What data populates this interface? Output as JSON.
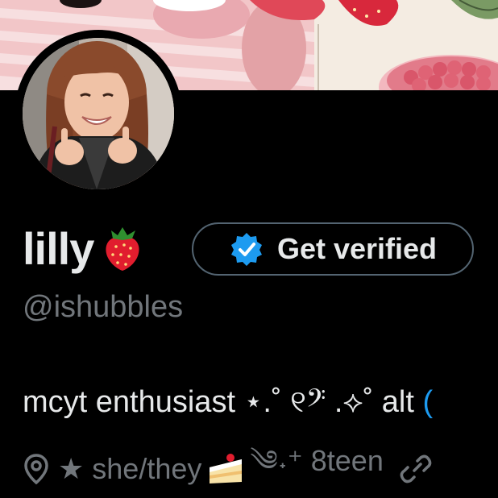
{
  "profile": {
    "display_name": "lilly",
    "name_emoji": "strawberry",
    "handle": "@ishubbles",
    "bio_main": "mcyt enthusiast ⋆.˚ ୧𝄢 .⟡˚ alt ",
    "bio_trailing": "(",
    "location_icon": "map-pin-icon",
    "meta_text": "★ she/they",
    "meta_text_2": "༄˖⁺ 8teen",
    "link_icon": "link-icon"
  },
  "actions": {
    "get_verified_label": "Get verified",
    "verified_icon": "verified-badge-icon"
  },
  "colors": {
    "background": "#000000",
    "primary_text": "#e7e9ea",
    "secondary_text": "#71767b",
    "accent": "#1d9bf0",
    "button_border": "#536471"
  }
}
